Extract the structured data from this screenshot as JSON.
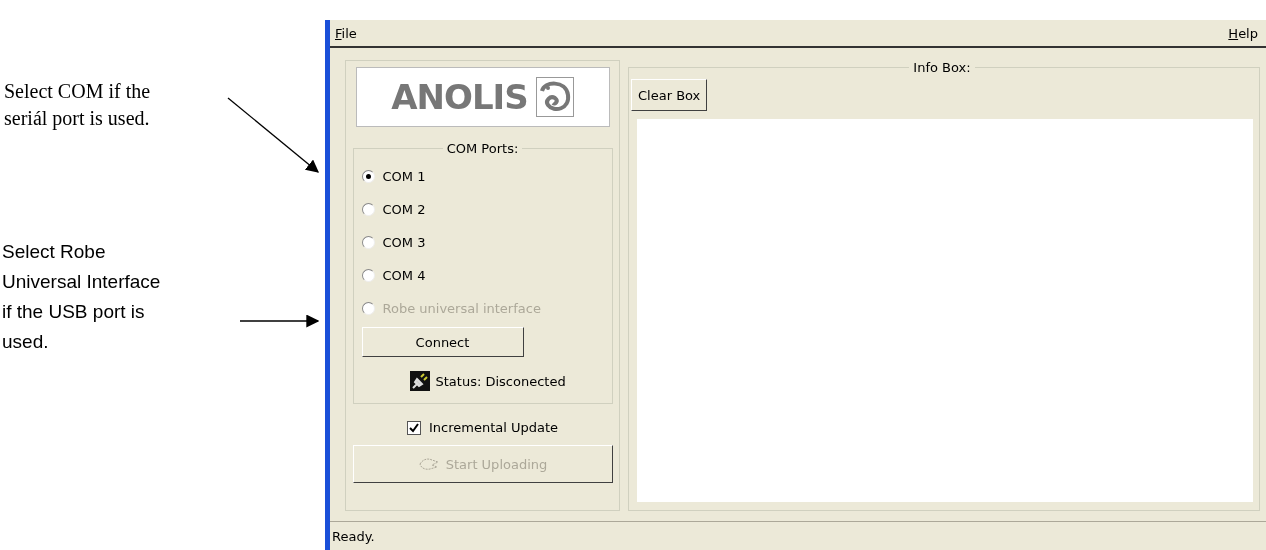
{
  "annotations": [
    {
      "text": "Select COM if the seriál port is used.",
      "kind": "serif"
    },
    {
      "text": "Select Robe Universal Interface if the USB port is used.",
      "kind": "sans"
    }
  ],
  "window": {
    "menu": [
      {
        "label": "File"
      },
      {
        "label": "Help"
      }
    ],
    "logo": {
      "text": "ANOLIS"
    },
    "com_ports": {
      "title": "COM Ports:",
      "options": [
        {
          "label": "COM 1",
          "selected": true,
          "disabled": false
        },
        {
          "label": "COM 2",
          "selected": false,
          "disabled": false
        },
        {
          "label": "COM 3",
          "selected": false,
          "disabled": false
        },
        {
          "label": "COM 4",
          "selected": false,
          "disabled": false
        },
        {
          "label": "Robe universal interface",
          "selected": false,
          "disabled": true
        }
      ],
      "connect_button": "Connect",
      "status": "Status: Disconected"
    },
    "incremental_update": {
      "label": "Incremental Update",
      "checked": true
    },
    "start_button": {
      "label": "Start Uploading",
      "disabled": true
    },
    "info_box": {
      "title": "Info Box:",
      "clear_button": "Clear Box"
    },
    "status_bar": "Ready."
  }
}
